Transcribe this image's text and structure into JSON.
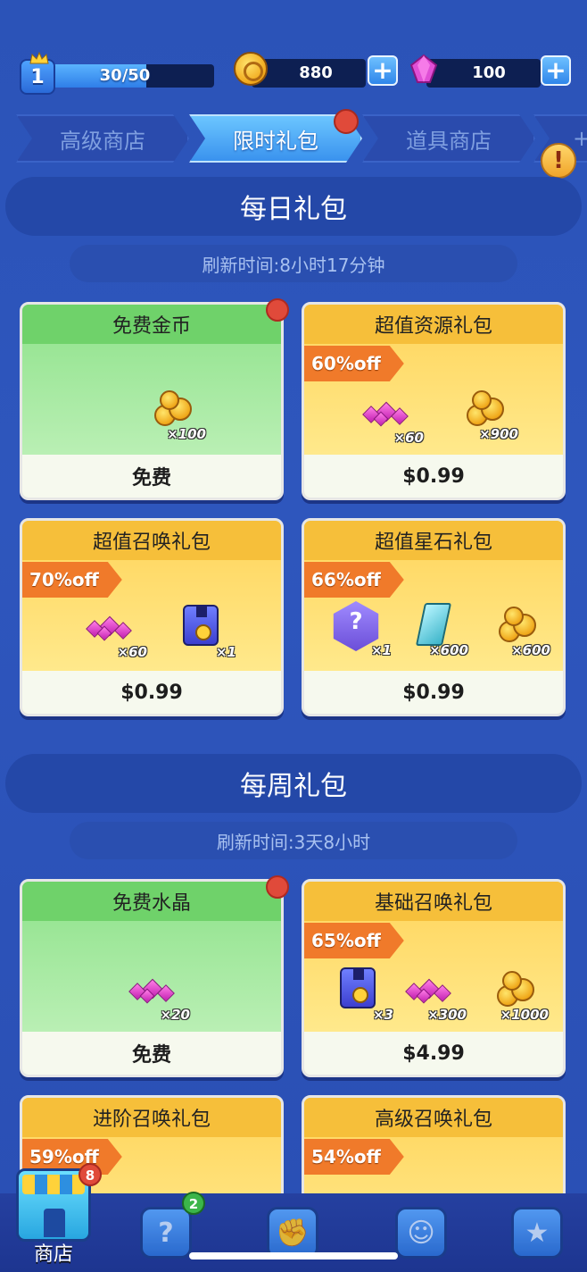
{
  "status_bar": {
    "level": "1",
    "xp_text": "30/50",
    "xp_progress": 0.6,
    "coins": "880",
    "gems": "100"
  },
  "tabs": [
    {
      "label": "高级商店",
      "active": false
    },
    {
      "label": "限时礼包",
      "active": true
    },
    {
      "label": "道具商店",
      "active": false
    },
    {
      "label": "+",
      "active": false
    }
  ],
  "daily": {
    "title": "每日礼包",
    "refresh": "刷新时间:8小时17分钟",
    "cards": [
      {
        "title": "免费金币",
        "price": "免费",
        "items": [
          {
            "icon": "coins-icon",
            "qty": "×100"
          }
        ]
      },
      {
        "title": "超值资源礼包",
        "discount": "60%off",
        "price": "$0.99",
        "items": [
          {
            "icon": "gems-icon",
            "qty": "×60"
          },
          {
            "icon": "coins-icon",
            "qty": "×900"
          }
        ]
      },
      {
        "title": "超值召唤礼包",
        "discount": "70%off",
        "price": "$0.99",
        "items": [
          {
            "icon": "gems-icon",
            "qty": "×60"
          },
          {
            "icon": "summon-card-icon",
            "qty": "×1"
          }
        ]
      },
      {
        "title": "超值星石礼包",
        "discount": "66%off",
        "price": "$0.99",
        "items": [
          {
            "icon": "mystery-hex-icon",
            "qty": "×1"
          },
          {
            "icon": "crystal-icon",
            "qty": "×600"
          },
          {
            "icon": "coins-icon",
            "qty": "×600"
          }
        ]
      }
    ]
  },
  "weekly": {
    "title": "每周礼包",
    "refresh": "刷新时间:3天8小时",
    "cards": [
      {
        "title": "免费水晶",
        "price": "免费",
        "items": [
          {
            "icon": "gems-icon",
            "qty": "×20"
          }
        ]
      },
      {
        "title": "基础召唤礼包",
        "discount": "65%off",
        "price": "$4.99",
        "items": [
          {
            "icon": "summon-card-icon",
            "qty": "×3"
          },
          {
            "icon": "gems-icon",
            "qty": "×300"
          },
          {
            "icon": "coins-icon",
            "qty": "×1000"
          }
        ]
      },
      {
        "title": "进阶召唤礼包",
        "discount": "59%off"
      },
      {
        "title": "高级召唤礼包",
        "discount": "54%off"
      }
    ]
  },
  "bottom_nav": {
    "shop_label": "商店",
    "shop_badge": "8",
    "cards_badge": "2"
  },
  "colors": {
    "background": "#2b53b8",
    "accent_blue": "#3a92ee",
    "discount_orange": "#f07a2a",
    "paid_card": "#f6bf3a",
    "free_card": "#6fd26a",
    "alert_red": "#e04a3a"
  }
}
